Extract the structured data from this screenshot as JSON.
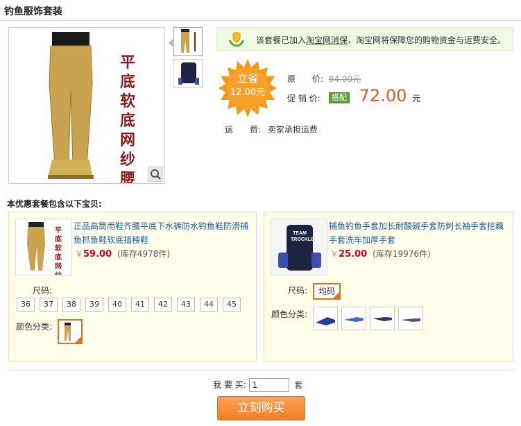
{
  "page_title": "钓鱼服饰套装",
  "main_image": {
    "caption": "平底软底网纱腰裤"
  },
  "notice": {
    "before": "该套餐已加入",
    "link": "淘宝网消保",
    "after": "，淘宝网将保障您的购物资金与运费安全。"
  },
  "savings": {
    "label": "立省",
    "amount": "12.00元"
  },
  "pricing": {
    "original_label": "原　　价:",
    "original_value": "84.00元",
    "promo_label": "促 销 价:",
    "promo_tag": "搭配",
    "promo_value": "72.00",
    "promo_unit": "元",
    "shipping_label": "运　　费:",
    "shipping_value": "卖家承担运费"
  },
  "bundle_heading": "本优惠套餐包含以下宝贝:",
  "products": [
    {
      "name": "正品高筒雨鞋齐腰平底下水裤防水钓鱼鞋防滑捕鱼抓鱼鞋软底插秧鞋",
      "yen": "￥",
      "price": "59.00",
      "stock": "(库存4978件)",
      "image_caption": "平底软底网纱腰裤",
      "size_label": "尺码:",
      "sizes": [
        "36",
        "37",
        "38",
        "39",
        "40",
        "41",
        "42",
        "43",
        "44",
        "45"
      ],
      "color_label": "颜色分类:"
    },
    {
      "name": "捕鱼钓鱼手套加长耐酸碱手套防刺长袖手套挖藕手套洗车加厚手套",
      "yen": "￥",
      "price": "25.00",
      "stock": "(库存19976件)",
      "image_caption": "TEAM TROCKLES",
      "size_label": "尺码:",
      "sizes": [
        "均码"
      ],
      "color_label": "颜色分类:"
    }
  ],
  "quantity": {
    "label": "我 要 买:",
    "value": "1",
    "unit": "套"
  },
  "buy_button": "立刻购买",
  "colors": {
    "accent": "#e4561b",
    "link": "#1f5fa6",
    "card_bg": "#fffcea",
    "notice_bg": "#f0f9e6"
  }
}
